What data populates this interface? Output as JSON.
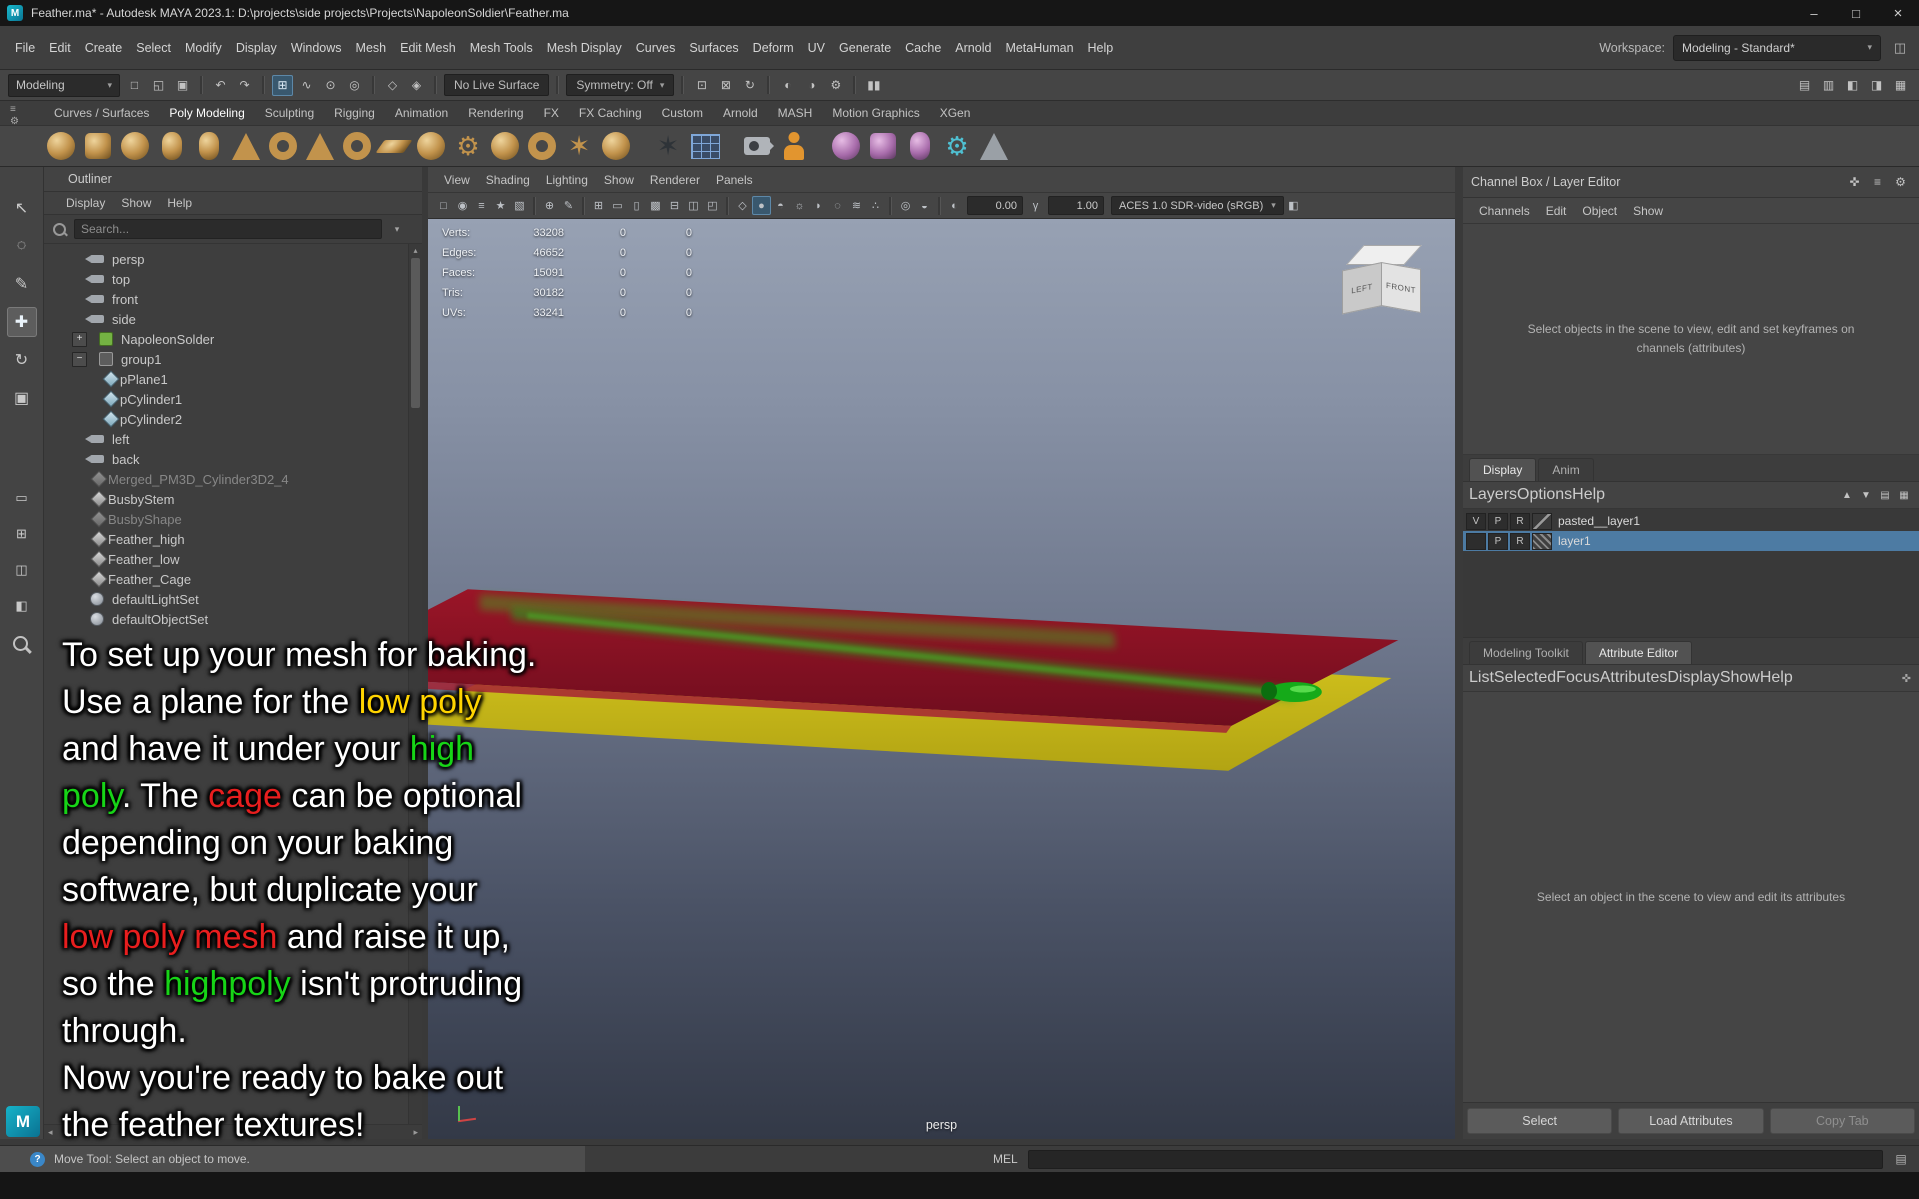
{
  "window": {
    "app_title": "Feather.ma* - Autodesk MAYA 2023.1: D:\\projects\\side projects\\Projects\\NapoleonSoldier\\Feather.ma",
    "controls": [
      {
        "name": "minimize",
        "glyph": "–"
      },
      {
        "name": "maximize",
        "glyph": "□"
      },
      {
        "name": "close",
        "glyph": "×"
      }
    ]
  },
  "menu_bar": {
    "items": [
      "File",
      "Edit",
      "Create",
      "Select",
      "Modify",
      "Display",
      "Windows",
      "Mesh",
      "Edit Mesh",
      "Mesh Tools",
      "Mesh Display",
      "Curves",
      "Surfaces",
      "Deform",
      "UV",
      "Generate",
      "Cache",
      "Arnold",
      "MetaHuman",
      "Help"
    ],
    "workspace_label": "Workspace:",
    "workspace_value": "Modeling - Standard*"
  },
  "status_line": {
    "menu_set": "Modeling",
    "elements": [
      {
        "k": "i",
        "name": "new-scene",
        "g": "□"
      },
      {
        "k": "i",
        "name": "open-scene",
        "g": "◱"
      },
      {
        "k": "i",
        "name": "save-scene",
        "g": "▣"
      },
      {
        "k": "d"
      },
      {
        "k": "i",
        "name": "undo",
        "g": "↶"
      },
      {
        "k": "i",
        "name": "redo",
        "g": "↷"
      },
      {
        "k": "d"
      },
      {
        "k": "i",
        "name": "snap-to-grid",
        "g": "⊞",
        "active": true
      },
      {
        "k": "i",
        "name": "snap-to-curve",
        "g": "∿"
      },
      {
        "k": "i",
        "name": "snap-to-point",
        "g": "⊙"
      },
      {
        "k": "i",
        "name": "snap-to-projected-center",
        "g": "◎"
      },
      {
        "k": "d"
      },
      {
        "k": "i",
        "name": "snap-to-view-plane",
        "g": "◇"
      },
      {
        "k": "i",
        "name": "make-object-live",
        "g": "◈"
      },
      {
        "k": "d"
      },
      {
        "k": "field",
        "name": "live-surface-field",
        "text": "No Live Surface"
      },
      {
        "k": "d"
      },
      {
        "k": "field",
        "name": "symmetry-field",
        "text": "Symmetry: Off",
        "arrow": true
      },
      {
        "k": "d"
      },
      {
        "k": "i",
        "name": "input-connections",
        "g": "⊡"
      },
      {
        "k": "i",
        "name": "output-connections",
        "g": "⊠"
      },
      {
        "k": "i",
        "name": "construction-history",
        "g": "↻"
      },
      {
        "k": "d"
      },
      {
        "k": "i",
        "name": "render-frame",
        "g": "◐"
      },
      {
        "k": "i",
        "name": "ipr-render",
        "g": "◑"
      },
      {
        "k": "i",
        "name": "render-settings",
        "g": "⚙"
      },
      {
        "k": "d"
      },
      {
        "k": "i",
        "name": "pause-viewport-updates",
        "g": "▮▮"
      }
    ],
    "right_icons": [
      {
        "name": "modeling-toolkit-toggle",
        "g": "▤"
      },
      {
        "name": "hypershade-toggle",
        "g": "▥"
      },
      {
        "name": "tool-settings-toggle",
        "g": "◧"
      },
      {
        "name": "attribute-editor-toggle",
        "g": "◨"
      },
      {
        "name": "channel-box-toggle",
        "g": "▦"
      }
    ]
  },
  "shelf": {
    "tabs": [
      "Curves / Surfaces",
      "Poly Modeling",
      "Sculpting",
      "Rigging",
      "Animation",
      "Rendering",
      "FX",
      "FX Caching",
      "Custom",
      "Arnold",
      "MASH",
      "Motion Graphics",
      "XGen"
    ],
    "active_tab": "Poly Modeling",
    "items": [
      {
        "name": "poly-sphere",
        "shape": "sphere",
        "pal": "gold"
      },
      {
        "name": "poly-cube",
        "shape": "cube",
        "pal": "gold"
      },
      {
        "name": "poly-ball",
        "shape": "sphere",
        "pal": "gold"
      },
      {
        "name": "poly-cylinder",
        "shape": "cyl",
        "pal": "gold"
      },
      {
        "name": "poly-capsule",
        "shape": "cyl",
        "pal": "gold"
      },
      {
        "name": "poly-cone",
        "shape": "cone",
        "pal": "gold"
      },
      {
        "name": "poly-torus",
        "shape": "ring",
        "pal": "gold"
      },
      {
        "name": "poly-pyramid",
        "shape": "cone",
        "pal": "gold"
      },
      {
        "name": "poly-pipe",
        "shape": "ring",
        "pal": "gold"
      },
      {
        "name": "poly-plane",
        "shape": "plane",
        "pal": "gold"
      },
      {
        "name": "poly-disc",
        "shape": "sphere",
        "pal": "gold"
      },
      {
        "name": "poly-gear",
        "shape": "gear",
        "pal": "gold"
      },
      {
        "name": "poly-soccer-ball",
        "shape": "sphere",
        "pal": "gold"
      },
      {
        "name": "poly-helix",
        "shape": "ring",
        "pal": "gold"
      },
      {
        "name": "poly-star",
        "shape": "star",
        "pal": "gold"
      },
      {
        "name": "poly-super-shape",
        "shape": "sphere",
        "pal": "gold"
      },
      {
        "sep": true
      },
      {
        "name": "sculpt-star",
        "shape": "star",
        "pal": "dark"
      },
      {
        "name": "quad-draw-grid",
        "shape": "grid",
        "pal": "blue"
      },
      {
        "sep": true
      },
      {
        "name": "camera-tool",
        "shape": "camera",
        "pal": "gray"
      },
      {
        "name": "human-figure",
        "shape": "person",
        "pal": "orange"
      },
      {
        "sep": true
      },
      {
        "name": "smooth-sphere",
        "shape": "sphere",
        "pal": "purple"
      },
      {
        "name": "smooth-cube",
        "shape": "cube",
        "pal": "purple"
      },
      {
        "name": "smooth-cylinder",
        "shape": "cyl",
        "pal": "purple"
      },
      {
        "name": "gears-tool",
        "shape": "gear",
        "pal": "teal"
      },
      {
        "name": "cone-and-sphere",
        "shape": "cone",
        "pal": "gray2"
      }
    ]
  },
  "toolbox": {
    "tools": [
      {
        "name": "select-tool",
        "glyph": "↖"
      },
      {
        "name": "lasso-select-tool",
        "glyph": "◌"
      },
      {
        "name": "paint-select-tool",
        "glyph": "✎"
      },
      {
        "name": "move-tool",
        "glyph": "✚",
        "active": true
      },
      {
        "name": "rotate-tool",
        "glyph": "↻"
      },
      {
        "name": "scale-tool",
        "glyph": "▣"
      }
    ],
    "layouts": [
      {
        "name": "layout-single-pane",
        "glyph": "▭"
      },
      {
        "name": "layout-four-pane",
        "glyph": "⊞"
      },
      {
        "name": "layout-persp-outliner",
        "glyph": "◫"
      },
      {
        "name": "layout-custom",
        "glyph": "◧"
      }
    ]
  },
  "outliner": {
    "panel_title": "Outliner",
    "menus": [
      "Display",
      "Show",
      "Help"
    ],
    "search_placeholder": "Search...",
    "items": [
      {
        "name": "persp",
        "icon": "cam",
        "level": 1
      },
      {
        "name": "top",
        "icon": "cam",
        "level": 1
      },
      {
        "name": "front",
        "icon": "cam",
        "level": 1
      },
      {
        "name": "side",
        "icon": "cam",
        "level": 1
      },
      {
        "name": "NapoleonSolder",
        "icon": "ref",
        "level": 0,
        "exp": "+"
      },
      {
        "name": "group1",
        "icon": "grp",
        "level": 0,
        "exp": "−"
      },
      {
        "name": "pPlane1",
        "icon": "mesh",
        "level": 2
      },
      {
        "name": "pCylinder1",
        "icon": "mesh",
        "level": 2
      },
      {
        "name": "pCylinder2",
        "icon": "mesh",
        "level": 2
      },
      {
        "name": "left",
        "icon": "cam",
        "level": 1
      },
      {
        "name": "back",
        "icon": "cam",
        "level": 1
      },
      {
        "name": "Merged_PM3D_Cylinder3D2_4",
        "icon": "meshg",
        "level": 1,
        "dim": true
      },
      {
        "name": "BusbyStem",
        "icon": "meshg",
        "level": 1
      },
      {
        "name": "BusbyShape",
        "icon": "meshg",
        "level": 1,
        "dim": true
      },
      {
        "name": "Feather_high",
        "icon": "meshg",
        "level": 1
      },
      {
        "name": "Feather_low",
        "icon": "meshg",
        "level": 1
      },
      {
        "name": "Feather_Cage",
        "icon": "meshg",
        "level": 1
      },
      {
        "name": "defaultLightSet",
        "icon": "set",
        "level": 1
      },
      {
        "name": "defaultObjectSet",
        "icon": "set",
        "level": 1
      }
    ]
  },
  "viewport": {
    "menus": [
      "View",
      "Shading",
      "Lighting",
      "Show",
      "Renderer",
      "Panels"
    ],
    "toolbar": [
      {
        "k": "i",
        "n": "select-camera",
        "g": "□"
      },
      {
        "k": "i",
        "n": "lock-camera",
        "g": "◉"
      },
      {
        "k": "i",
        "n": "camera-attributes",
        "g": "≡"
      },
      {
        "k": "i",
        "n": "bookmark-view",
        "g": "★"
      },
      {
        "k": "i",
        "n": "image-plane",
        "g": "▧"
      },
      {
        "k": "d"
      },
      {
        "k": "i",
        "n": "2d-pan-zoom",
        "g": "⊕"
      },
      {
        "k": "i",
        "n": "grease-pencil",
        "g": "✎"
      },
      {
        "k": "d"
      },
      {
        "k": "i",
        "n": "grid-toggle",
        "g": "⊞"
      },
      {
        "k": "i",
        "n": "film-gate",
        "g": "▭"
      },
      {
        "k": "i",
        "n": "resolution-gate",
        "g": "▯"
      },
      {
        "k": "i",
        "n": "gate-mask",
        "g": "▩"
      },
      {
        "k": "i",
        "n": "field-chart",
        "g": "⊟"
      },
      {
        "k": "i",
        "n": "safe-action",
        "g": "◫"
      },
      {
        "k": "i",
        "n": "safe-title",
        "g": "◰"
      },
      {
        "k": "d"
      },
      {
        "k": "i",
        "n": "wireframe-display",
        "g": "◇"
      },
      {
        "k": "i",
        "n": "shaded-display",
        "g": "●",
        "active": true
      },
      {
        "k": "i",
        "n": "textured-display",
        "g": "◓"
      },
      {
        "k": "i",
        "n": "lighting-toggle",
        "g": "☼"
      },
      {
        "k": "i",
        "n": "shadows-toggle",
        "g": "◗"
      },
      {
        "k": "i",
        "n": "ambient-occlusion",
        "g": "◌"
      },
      {
        "k": "i",
        "n": "motion-blur",
        "g": "≋"
      },
      {
        "k": "i",
        "n": "anti-aliasing",
        "g": "∴"
      },
      {
        "k": "d"
      },
      {
        "k": "i",
        "n": "isolate-select",
        "g": "◎"
      },
      {
        "k": "i",
        "n": "xray-display",
        "g": "◒"
      },
      {
        "k": "d"
      },
      {
        "k": "i",
        "n": "exposure",
        "g": "◐"
      },
      {
        "k": "num",
        "n": "exposure-value",
        "bind": "exposure"
      },
      {
        "k": "i",
        "n": "gamma",
        "g": "γ"
      },
      {
        "k": "num",
        "n": "gamma-value",
        "bind": "gamma"
      },
      {
        "k": "sel",
        "n": "color-space-select",
        "bind": "color_space"
      },
      {
        "k": "i",
        "n": "snapshot-cube",
        "g": "◧"
      }
    ],
    "exposure": "0.00",
    "gamma": "1.00",
    "color_space": "ACES 1.0 SDR-video (sRGB)",
    "camera_label": "persp",
    "view_cube": {
      "left_face": "LEFT",
      "front_face": "FRONT"
    },
    "hud": {
      "rows": [
        {
          "label": "Verts:",
          "value": "33208",
          "c1": "0",
          "c2": "0"
        },
        {
          "label": "Edges:",
          "value": "46652",
          "c1": "0",
          "c2": "0"
        },
        {
          "label": "Faces:",
          "value": "15091",
          "c1": "0",
          "c2": "0"
        },
        {
          "label": "Tris:",
          "value": "30182",
          "c1": "0",
          "c2": "0"
        },
        {
          "label": "UVs:",
          "value": "33241",
          "c1": "0",
          "c2": "0"
        }
      ]
    },
    "scene_colors": {
      "high_poly_plane": "#8c1022",
      "low_poly_plane": "#d2c31f",
      "feather_strands": "#2f9e1d",
      "quill": "#15aa19",
      "background_top": "#97a1b3",
      "background_bottom": "#333947"
    }
  },
  "channel_box": {
    "title": "Channel Box / Layer Editor",
    "menus": [
      "Channels",
      "Edit",
      "Object",
      "Show"
    ],
    "header_icons": [
      {
        "name": "pin-panel",
        "g": "✜"
      },
      {
        "name": "panel-menu",
        "g": "≡"
      },
      {
        "name": "panel-options",
        "g": "⚙"
      }
    ],
    "message": "Select objects in the scene to view, edit and set keyframes on channels (attributes)"
  },
  "layer_editor": {
    "tabs": [
      "Display",
      "Anim"
    ],
    "active_tab": "Display",
    "menus": [
      "Layers",
      "Options",
      "Help"
    ],
    "toolbar_icons": [
      {
        "name": "layer-move-up",
        "g": "▲"
      },
      {
        "name": "layer-move-down",
        "g": "▼"
      },
      {
        "name": "create-empty-layer",
        "g": "▤"
      },
      {
        "name": "create-layer-from-selected",
        "g": "▦"
      }
    ],
    "layers": [
      {
        "v": "V",
        "p": "P",
        "r": "R",
        "name": "pasted__layer1",
        "selected": false
      },
      {
        "v": "",
        "p": "P",
        "r": "R",
        "name": "layer1",
        "selected": true
      }
    ]
  },
  "attribute_panel": {
    "tabs": [
      "Modeling Toolkit",
      "Attribute Editor"
    ],
    "active_tab": "Attribute Editor",
    "menus": [
      "List",
      "Selected",
      "Focus",
      "Attributes",
      "Display",
      "Show",
      "Help"
    ],
    "message": "Select an object in the scene to view and edit its attributes",
    "buttons": [
      {
        "label": "Select"
      },
      {
        "label": "Load Attributes"
      },
      {
        "label": "Copy Tab",
        "dim": true
      }
    ]
  },
  "command_line": {
    "label": "MEL"
  },
  "help_line": {
    "text": "Move Tool: Select an object to move."
  },
  "overlay": {
    "font_colors": {
      "white": "#ffffff",
      "yellow": "#ffd400",
      "green": "#17d417",
      "red": "#e81e1e"
    },
    "lines": [
      [
        {
          "t": "To set up your mesh for baking.",
          "c": "white"
        }
      ],
      [
        {
          "t": "Use a plane for the ",
          "c": "white"
        },
        {
          "t": "low poly",
          "c": "yellow"
        }
      ],
      [
        {
          "t": "and have it under your ",
          "c": "white"
        },
        {
          "t": "high",
          "c": "green"
        }
      ],
      [
        {
          "t": "poly",
          "c": "green"
        },
        {
          "t": ". The ",
          "c": "white"
        },
        {
          "t": "cage",
          "c": "red"
        },
        {
          "t": " can be optional",
          "c": "white"
        }
      ],
      [
        {
          "t": "depending on your baking",
          "c": "white"
        }
      ],
      [
        {
          "t": "software, but duplicate your",
          "c": "white"
        }
      ],
      [
        {
          "t": "low poly mesh",
          "c": "red"
        },
        {
          "t": " and raise it up,",
          "c": "white"
        }
      ],
      [
        {
          "t": "so the ",
          "c": "white"
        },
        {
          "t": "highpoly",
          "c": "green"
        },
        {
          "t": " isn't protruding",
          "c": "white"
        }
      ],
      [
        {
          "t": "through.",
          "c": "white"
        }
      ],
      [
        {
          "t": "Now you're ready to bake out",
          "c": "white"
        }
      ],
      [
        {
          "t": "the feather textures!",
          "c": "white"
        }
      ]
    ]
  }
}
